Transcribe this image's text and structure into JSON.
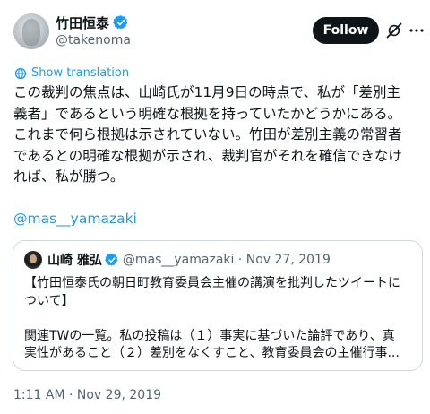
{
  "author": {
    "display_name": "竹田恒泰",
    "handle": "@takenoma",
    "verified": true
  },
  "header": {
    "follow_label": "Follow"
  },
  "translate": {
    "label": "Show translation"
  },
  "tweet": {
    "lines": [
      "この裁判の焦点は、山崎氏が11月9日の時点で、私が「差別主",
      "義者」であるという明確な根拠を持っていたかどうかにある。",
      "これまで何ら根拠は示されていない。竹田が差別主義の常習者",
      "であるとの明確な根拠が示され、裁判官がそれを確信できなけ",
      "れば、私が勝つ。"
    ],
    "mention": "@mas__yamazaki",
    "timestamp": "1:11 AM · Nov 29, 2019"
  },
  "quote": {
    "display_name": "山崎 雅弘",
    "handle": "@mas__yamazaki",
    "meta": "@mas__yamazaki · Nov 27, 2019",
    "lines": [
      "【竹田恒泰氏の朝日町教育委員会主催の講演を批判したツイートに",
      "ついて】",
      "",
      "関連TWの一覧。私の投稿は（１）事実に基づいた論評であり、真",
      "実性があること（２）差別をなくすこと、教育委員会の主催行事..."
    ]
  },
  "colors": {
    "accent": "#1d9bf0",
    "text": "#0f1419",
    "secondary": "#536471",
    "border": "#cfd9de",
    "button_bg": "#0f1419"
  },
  "icons": {
    "verified": "verified-badge-icon",
    "grok": "grok-icon",
    "more": "more-dots-icon",
    "translate": "globe-icon"
  }
}
